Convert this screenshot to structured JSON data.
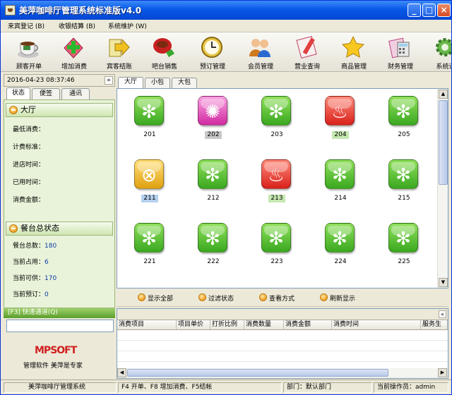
{
  "window": {
    "title": "美萍咖啡厅管理系统标准版v4.0"
  },
  "menu": [
    "来宾登记 (B)",
    "收银结算 (B)",
    "系统维护 (W)"
  ],
  "toolbar": [
    {
      "label": "顾客开单",
      "icon": "coffee-cup-icon"
    },
    {
      "label": "增加消费",
      "icon": "add-consumption-icon"
    },
    {
      "label": "宾客结账",
      "icon": "checkout-arrow-icon"
    },
    {
      "label": "吧台销售",
      "icon": "bar-sales-icon"
    },
    {
      "label": "预订管理",
      "icon": "clock-icon"
    },
    {
      "label": "会员管理",
      "icon": "members-icon"
    },
    {
      "label": "营业查询",
      "icon": "report-query-icon"
    },
    {
      "label": "商品管理",
      "icon": "star-icon"
    },
    {
      "label": "财务管理",
      "icon": "calculator-icon"
    },
    {
      "label": "系统设",
      "icon": "gear-icon"
    }
  ],
  "left": {
    "datetime": "2016-04-23 08:37:46",
    "tabs": [
      "状态",
      "便签",
      "通讯"
    ],
    "hall_section": "大厅",
    "hall_fields": [
      {
        "label": "最低消费：",
        "value": ""
      },
      {
        "label": "计费标准：",
        "value": ""
      },
      {
        "label": "进店时间：",
        "value": ""
      },
      {
        "label": "已用时间：",
        "value": ""
      },
      {
        "label": "消费金额：",
        "value": ""
      }
    ],
    "status_section": "餐台总状态",
    "status_fields": [
      {
        "label": "餐台总数：",
        "value": "180"
      },
      {
        "label": "当前占用：",
        "value": "6"
      },
      {
        "label": "当前可供：",
        "value": "170"
      },
      {
        "label": "当前预订：",
        "value": "0"
      }
    ],
    "quick_title": "[F3] 快速通道(Q)",
    "quick_input_value": "",
    "logo_text": "MPSOFT",
    "slogan": "管理软件 美萍是专家"
  },
  "room_tabs": [
    "大厅",
    "小包",
    "大包"
  ],
  "rooms": [
    {
      "num": "201",
      "status": "free",
      "label_hl": ""
    },
    {
      "num": "202",
      "status": "booked",
      "label_hl": "grey"
    },
    {
      "num": "203",
      "status": "free",
      "label_hl": ""
    },
    {
      "num": "204",
      "status": "occupied",
      "label_hl": "green"
    },
    {
      "num": "205",
      "status": "free",
      "label_hl": ""
    },
    {
      "num": "211",
      "status": "cleaning",
      "label_hl": "blue"
    },
    {
      "num": "212",
      "status": "free",
      "label_hl": ""
    },
    {
      "num": "213",
      "status": "occupied",
      "label_hl": "green"
    },
    {
      "num": "214",
      "status": "free",
      "label_hl": ""
    },
    {
      "num": "215",
      "status": "free",
      "label_hl": ""
    },
    {
      "num": "221",
      "status": "free",
      "label_hl": ""
    },
    {
      "num": "222",
      "status": "free",
      "label_hl": ""
    },
    {
      "num": "223",
      "status": "free",
      "label_hl": ""
    },
    {
      "num": "224",
      "status": "free",
      "label_hl": ""
    },
    {
      "num": "225",
      "status": "free",
      "label_hl": ""
    }
  ],
  "actions": [
    "显示全部",
    "过滤状态",
    "查看方式",
    "刷新显示"
  ],
  "detail_columns": [
    "消费项目",
    "项目单价",
    "打折比例",
    "消费数量",
    "消费金额",
    "消费时间",
    "服务生"
  ],
  "statusbar": {
    "app": "美萍咖啡厅管理系统",
    "hint": "F4 开单、F8 增加消费、F5结帐",
    "dept": "部门：默认部门",
    "operator": "当前操作员：admin"
  }
}
